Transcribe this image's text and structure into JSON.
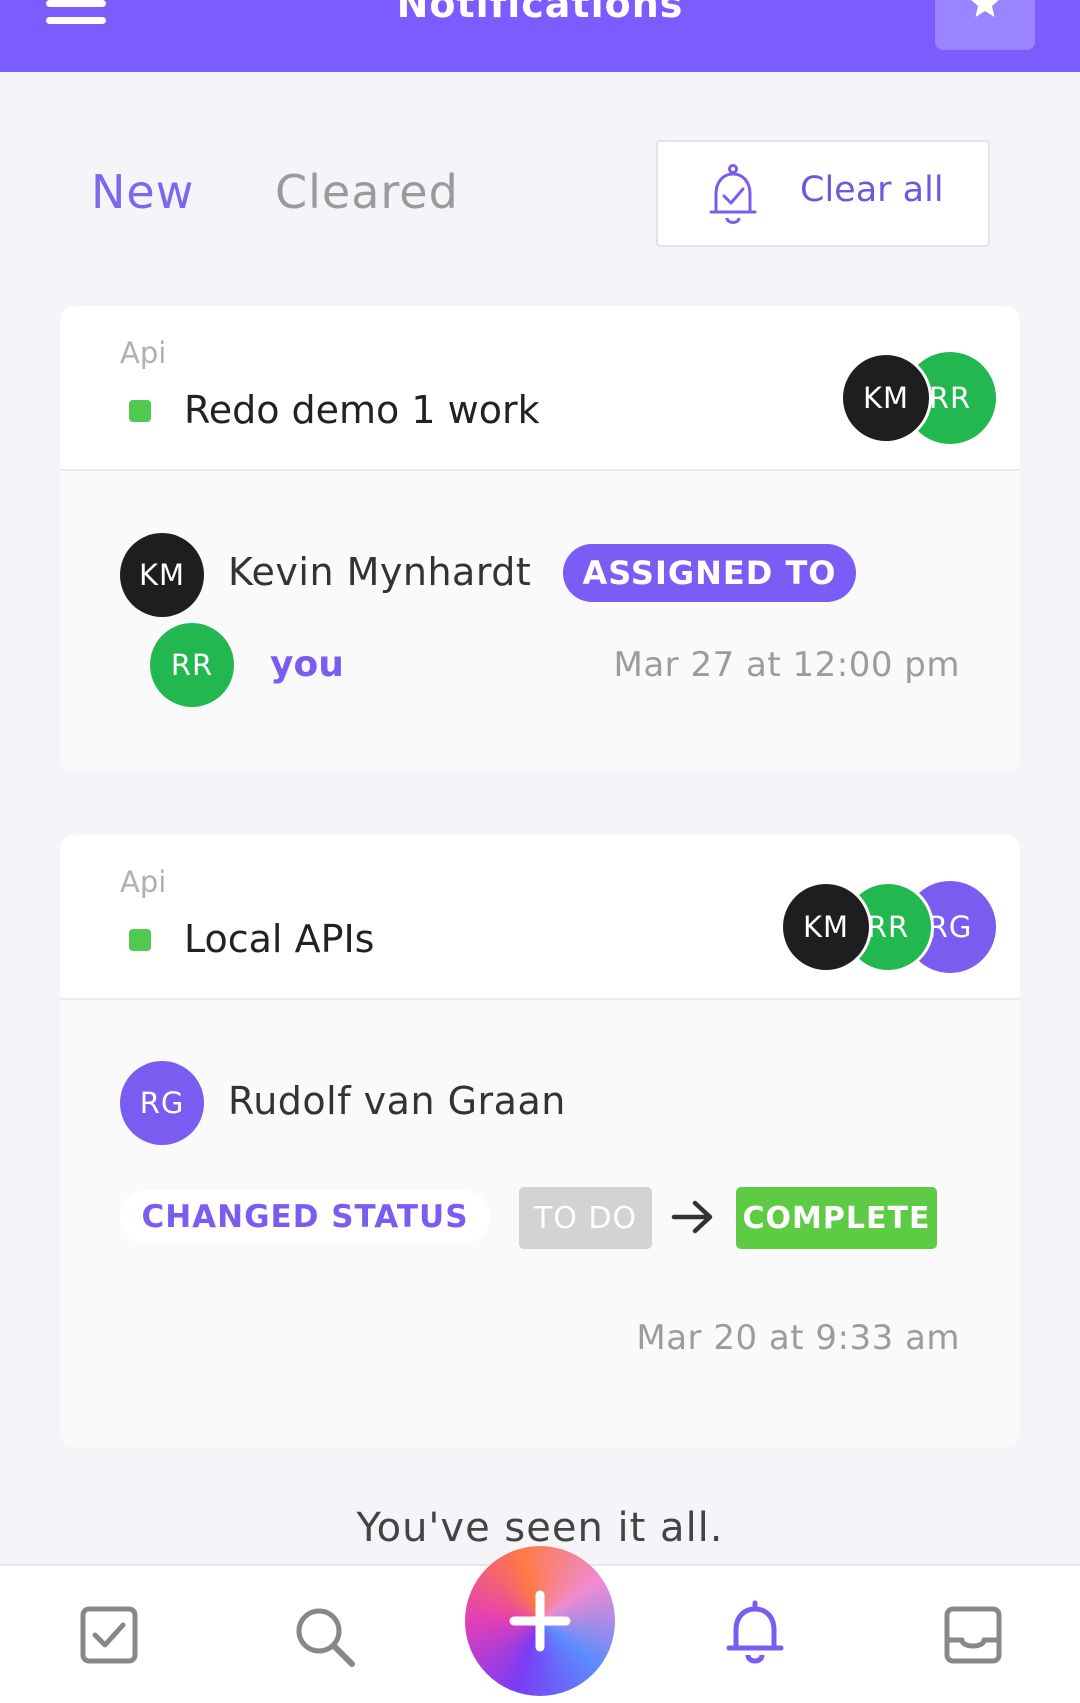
{
  "header": {
    "title": "Notifications",
    "menu_icon": "hamburger-icon",
    "action_icon": "star-icon"
  },
  "tabs": {
    "new": "New",
    "cleared": "Cleared",
    "clear_all": "Clear all"
  },
  "notifications": [
    {
      "crumb": "Api",
      "task": "Redo demo 1 work",
      "head_avatars": [
        "KM",
        "RR"
      ],
      "actor_initials": "KM",
      "actor_name": "Kevin Mynhardt",
      "action": "ASSIGNED TO",
      "target_initials": "RR",
      "target": "you",
      "time": "Mar 27 at 12:00 pm"
    },
    {
      "crumb": "Api",
      "task": "Local APIs",
      "head_avatars": [
        "KM",
        "RR",
        "RG"
      ],
      "actor_initials": "RG",
      "actor_name": "Rudolf van Graan",
      "action": "CHANGED STATUS",
      "from_status": "TO DO",
      "to_status": "COMPLETE",
      "time": "Mar 20 at 9:33 am"
    }
  ],
  "end_message": "You've seen it all.",
  "colors": {
    "accent": "#7b5cff",
    "status_green": "#5ecb45",
    "avatar_km": "#1e1e1e",
    "avatar_rr": "#22b84f",
    "avatar_rg": "#7b5cf0"
  },
  "bottom_nav": [
    "tasks-icon",
    "search-icon",
    "add-icon",
    "notifications-icon",
    "inbox-icon"
  ]
}
